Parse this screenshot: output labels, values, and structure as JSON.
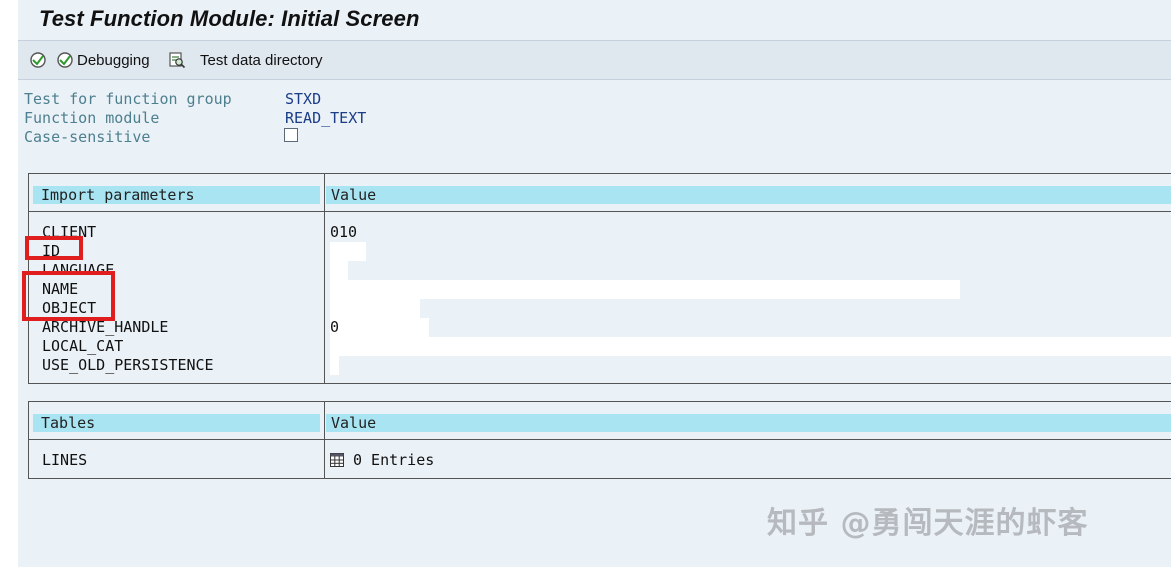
{
  "window": {
    "title": "Test Function Module: Initial Screen"
  },
  "toolbar": {
    "execute_icon": "execute-icon",
    "debugging_label": "Debugging",
    "test_data_directory_label": "Test data directory"
  },
  "form": {
    "function_group_label": "Test for function group",
    "function_group_value": "STXD",
    "function_module_label": "Function module",
    "function_module_value": "READ_TEXT",
    "case_sensitive_label": "Case-sensitive",
    "case_sensitive_checked": false
  },
  "import_table": {
    "header_param": "Import parameters",
    "header_value": "Value",
    "rows": [
      {
        "name": "CLIENT",
        "value": "010"
      },
      {
        "name": "ID",
        "value": ""
      },
      {
        "name": "LANGUAGE",
        "value": ""
      },
      {
        "name": "NAME",
        "value": ""
      },
      {
        "name": "OBJECT",
        "value": ""
      },
      {
        "name": "ARCHIVE_HANDLE",
        "value": "0"
      },
      {
        "name": "LOCAL_CAT",
        "value": ""
      },
      {
        "name": "USE_OLD_PERSISTENCE",
        "value": ""
      }
    ]
  },
  "tables_table": {
    "header_param": "Tables",
    "header_value": "Value",
    "rows": [
      {
        "name": "LINES",
        "value": "0 Entries"
      }
    ]
  },
  "watermark": "知乎 @勇闯天涯的虾客",
  "colors": {
    "background": "#eaf1f7",
    "header_cyan": "#a8e4f2",
    "highlight_red": "#e01e1e",
    "label_teal": "#4e7f8e",
    "value_blue": "#1b3c87"
  }
}
